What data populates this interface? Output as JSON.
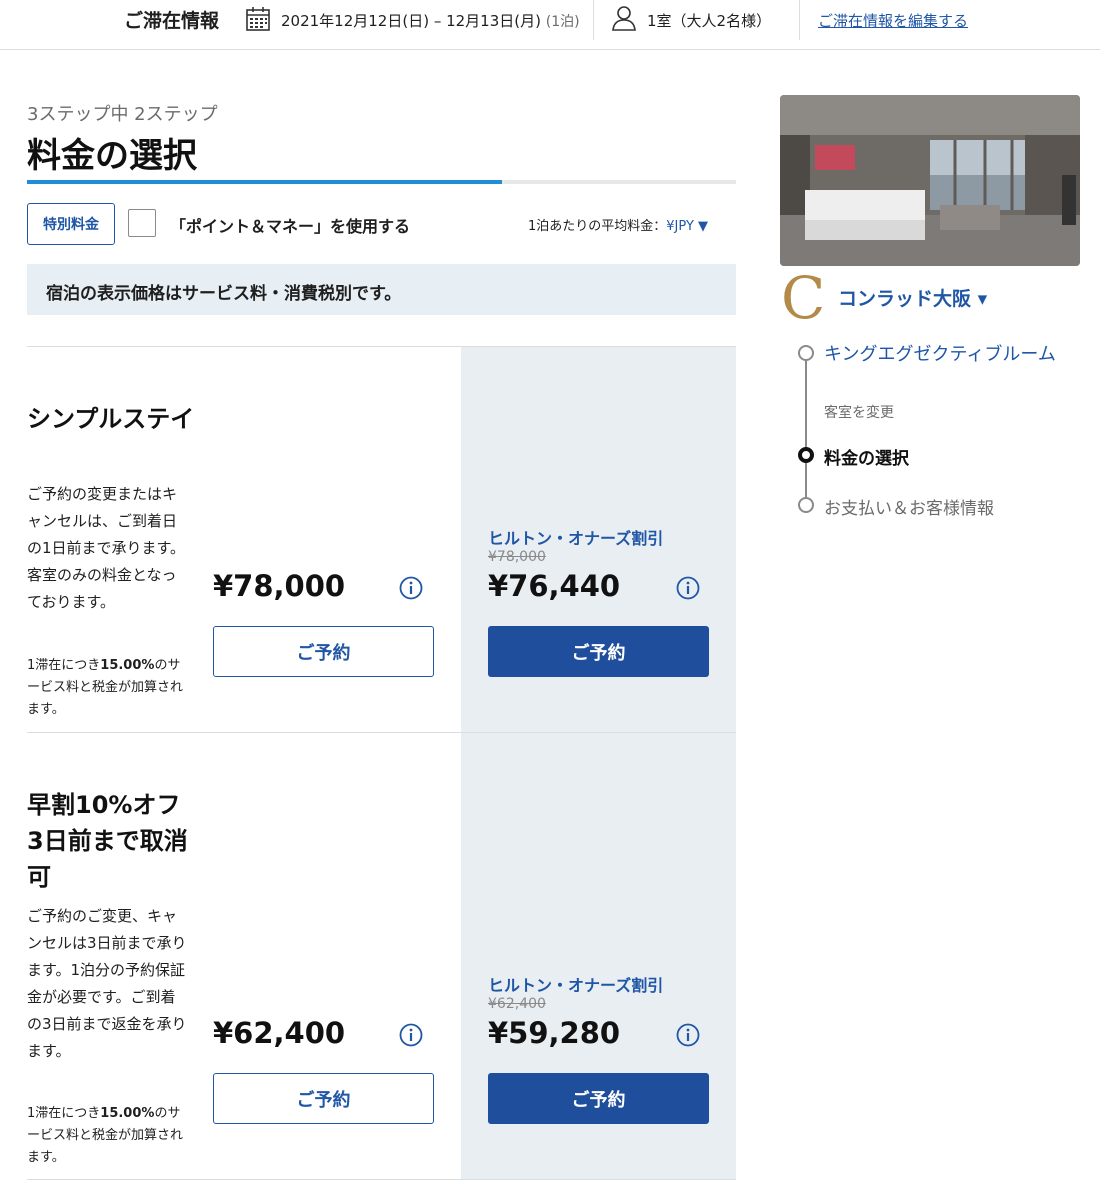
{
  "stay_bar": {
    "title": "ご滞在情報",
    "dates": "2021年12月12日(日) – 12月13日(月)",
    "nights": "(1泊)",
    "rooms_guests": "1室（大人2名様）",
    "edit_link": "ご滞在情報を編集する"
  },
  "header": {
    "step": "3ステップ中 2ステップ",
    "title": "料金の選択",
    "progress_fraction": 0.67
  },
  "controls": {
    "special_rate_button": "特別料金",
    "points_money_label": "「ポイント＆マネー」を使用する",
    "avg_rate_label": "1泊あたりの平均料金：",
    "currency": "¥JPY ▼"
  },
  "notice": {
    "text": "宿泊の表示価格はサービス料・消費税別です。"
  },
  "rates": [
    {
      "name": "シンプルステイ",
      "description": "ご予約の変更またはキャンセルは、ご到着日の1日前まで承ります。客室のみの料金となっております。",
      "tax_prefix": "1滞在につき",
      "tax_percent": "15.00%",
      "tax_suffix": "のサービス料と税金が加算されます。",
      "standard_price": "¥78,000",
      "book_label": "ご予約",
      "honors_label": "ヒルトン・オナーズ割引",
      "honors_original": "¥78,000",
      "honors_price": "¥76,440",
      "honors_book_label": "ご予約"
    },
    {
      "name": "早割10%オフ3日前まで取消可",
      "description": "ご予約のご変更、キャンセルは3日前まで承ります。1泊分の予約保証金が必要です。ご到着の3日前まで返金を承ります。",
      "tax_prefix": "1滞在につき",
      "tax_percent": "15.00%",
      "tax_suffix": "のサービス料と税金が加算されます。",
      "standard_price": "¥62,400",
      "book_label": "ご予約",
      "honors_label": "ヒルトン・オナーズ割引",
      "honors_original": "¥62,400",
      "honors_price": "¥59,280",
      "honors_book_label": "ご予約"
    }
  ],
  "sidebar": {
    "logo_letter": "C",
    "hotel_name": "コンラッド大阪 ▾",
    "room_name": "キングエグゼクティブルーム",
    "change_room": "客室を変更",
    "current_step": "料金の選択",
    "next_step": "お支払い＆お客様情報"
  },
  "colors": {
    "brand_blue": "#1f56a6",
    "progress_blue": "#1f8ed6",
    "logo_gold": "#b38a4a",
    "honors_bg": "#e9eef3"
  },
  "icons": [
    "calendar-icon",
    "person-icon",
    "info-icon",
    "chevron-down-icon"
  ]
}
